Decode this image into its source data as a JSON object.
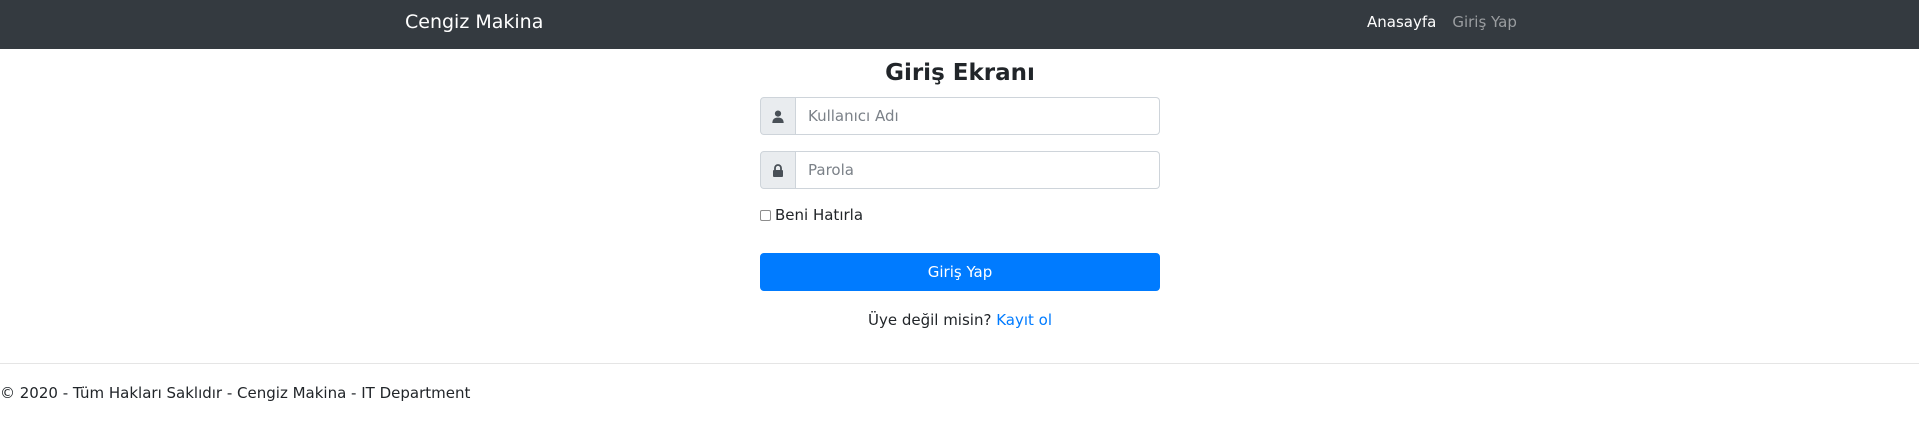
{
  "navbar": {
    "brand": "Cengiz Makina",
    "links": [
      {
        "label": "Anasayfa",
        "active": true
      },
      {
        "label": "Giriş Yap",
        "active": false
      }
    ],
    "background": "#343a40"
  },
  "login": {
    "title": "Giriş Ekranı",
    "username": {
      "placeholder": "Kullanıcı Adı",
      "value": "",
      "icon": "user-icon"
    },
    "password": {
      "placeholder": "Parola",
      "value": "",
      "icon": "lock-icon"
    },
    "remember_label": "Beni Hatırla",
    "remember_checked": false,
    "submit_label": "Giriş Yap",
    "register_prompt": "Üye değil misin?",
    "register_link": "Kayıt ol",
    "accent": "#007bff"
  },
  "footer": {
    "text": "© 2020 - Tüm Hakları Saklıdır - Cengiz Makina - IT Department"
  }
}
